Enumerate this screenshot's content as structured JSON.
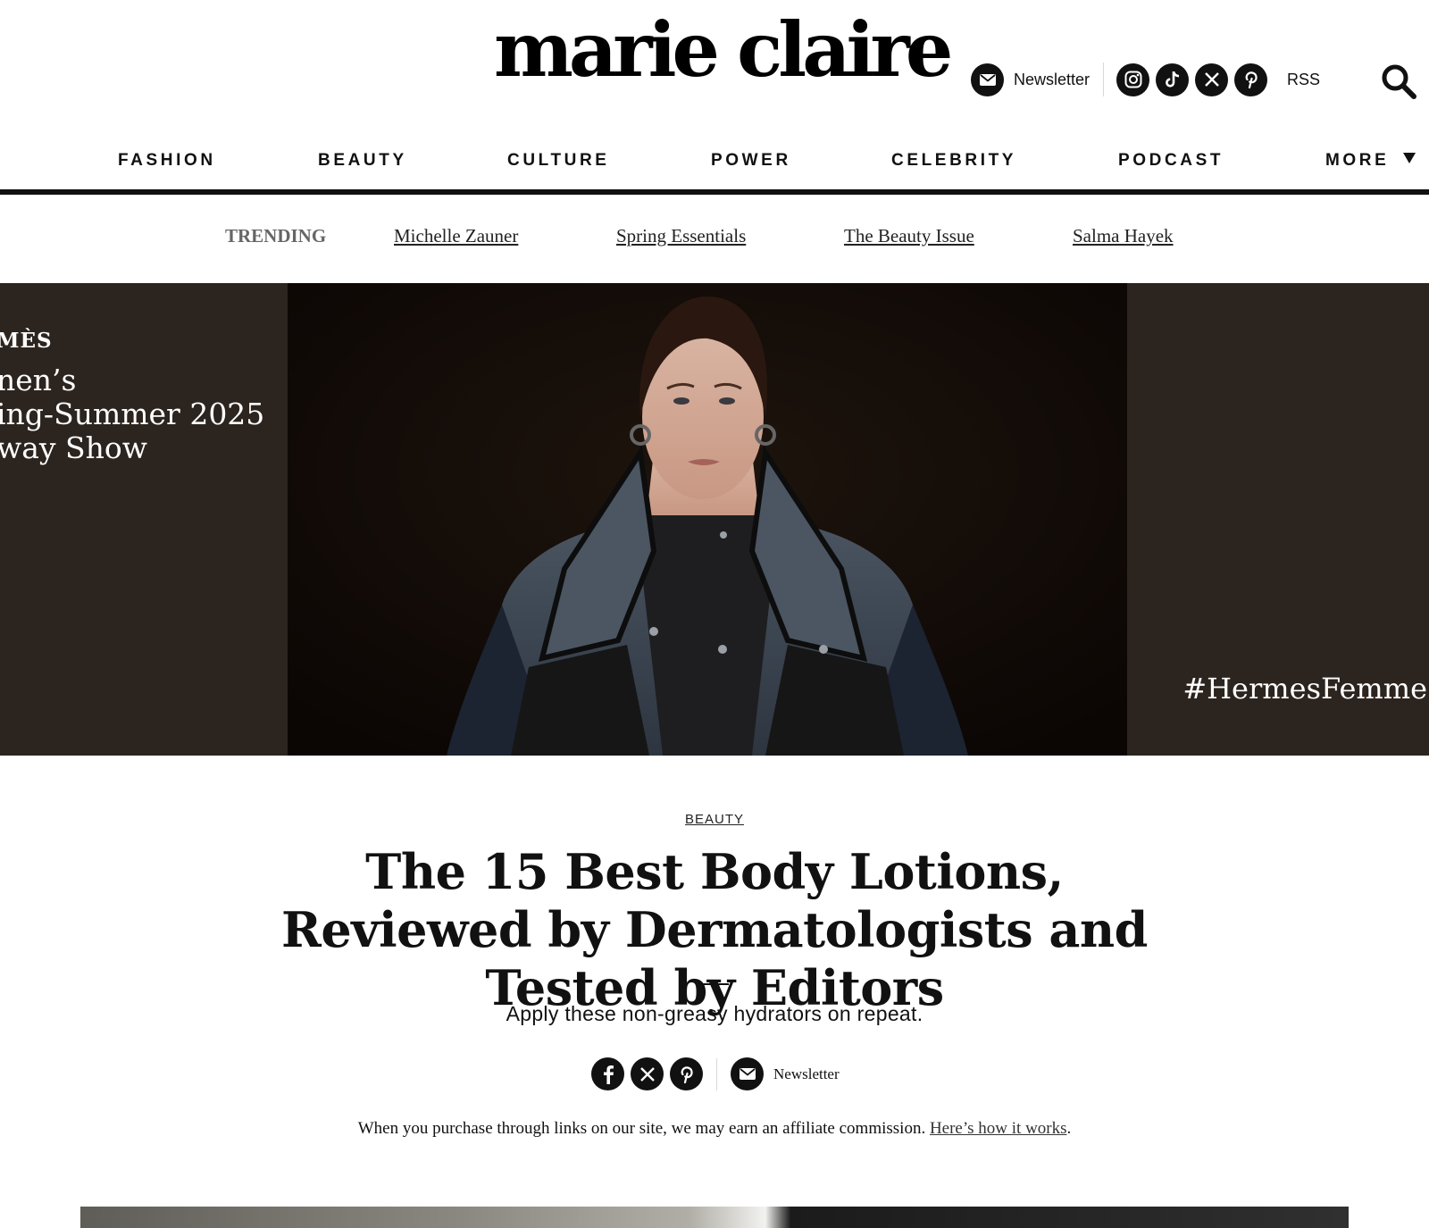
{
  "header": {
    "logo": "marie claire",
    "newsletter_label": "Newsletter",
    "social_icons": [
      "instagram-icon",
      "tiktok-icon",
      "x-icon",
      "pinterest-icon"
    ],
    "rss_label": "RSS",
    "search_icon": "search-icon"
  },
  "nav": {
    "items": [
      "FASHION",
      "BEAUTY",
      "CULTURE",
      "POWER",
      "CELEBRITY",
      "PODCAST",
      "MORE"
    ],
    "more_icon": "caret-down-icon"
  },
  "trending": {
    "label": "TRENDING",
    "links": [
      "Michelle Zauner",
      "Spring Essentials",
      "The Beauty Issue",
      "Salma Hayek"
    ]
  },
  "hero": {
    "brand_fragment": "MÈS",
    "lines": [
      "nen’s",
      "ing-Summer 2025",
      "way Show"
    ],
    "hashtag": "#HermesFemme"
  },
  "article": {
    "category": "BEAUTY",
    "headline": "The 15 Best Body Lotions, Reviewed by Dermatologists and Tested by Editors",
    "deck": "Apply these non-greasy hydrators on repeat.",
    "share_icons": [
      "facebook-icon",
      "x-icon",
      "pinterest-icon"
    ],
    "share_newsletter_label": "Newsletter",
    "disclaimer_text": "When you purchase through links on our site, we may earn an affiliate commission.",
    "disclaimer_link": "Here’s how it works",
    "disclaimer_end": "."
  }
}
